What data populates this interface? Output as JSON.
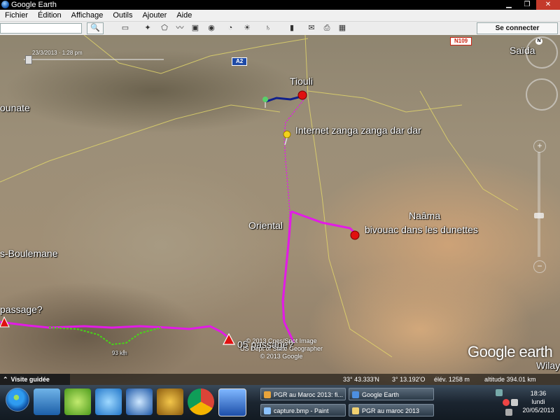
{
  "window": {
    "title": "Google Earth"
  },
  "menu": [
    "Fichier",
    "Édition",
    "Affichage",
    "Outils",
    "Ajouter",
    "Aide"
  ],
  "toolbar": {
    "search_button": "🔍",
    "connect_label": "Se connecter"
  },
  "map": {
    "timestamp": "23/3/2013 · 1:28 pm",
    "shields": {
      "a2": "A2",
      "n109": "N109"
    },
    "labels": {
      "tiouli": "Tiouli",
      "internet": "Internet zanga zanga dar dar",
      "oriental": "Oriental",
      "naama": "Naâma",
      "bivouac": "bivouac dans les dunettes",
      "boulemane": "s-Boulemane",
      "passage_left": "passage?",
      "passage_05": "05 passage?",
      "bounate": "ounate",
      "saida": "Saïda",
      "wilaya": "Wilay",
      "km": "93 km"
    },
    "copyright": [
      "© 2013 Cnes/Spot Image",
      "US Dept of State Geographer",
      "© 2013 Google"
    ],
    "logo": "Google earth",
    "route_color": "#e21be6",
    "alt_route_color": "#46d816",
    "start_route_color": "#10208c"
  },
  "status": {
    "tour_label": "Visite guidée",
    "lat": "33° 43.333'N",
    "lon": "3° 13.192'O",
    "elev": "élév. 1258 m",
    "alt": "altitude 394.01 km"
  },
  "taskbar": {
    "tasks": [
      "PGR au Maroc 2013: fi...",
      "Google Earth",
      "capture.bmp - Paint",
      "PGR au maroc 2013"
    ],
    "time": "18:36",
    "day": "lundi",
    "date": "20/05/2013"
  }
}
